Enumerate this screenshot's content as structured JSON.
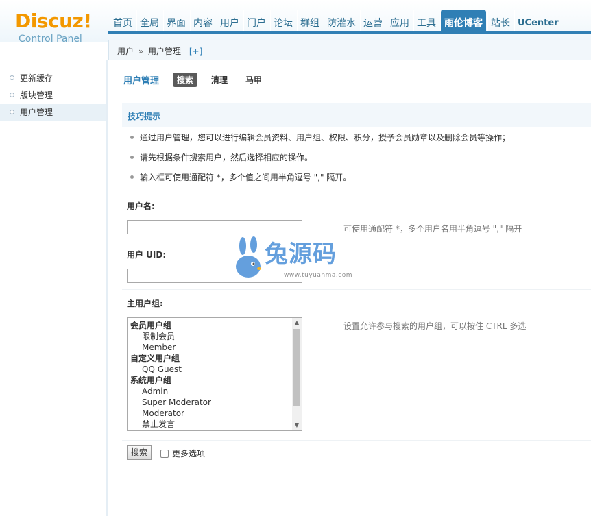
{
  "logo": {
    "brand": "Discuz!",
    "subtitle": "Control Panel"
  },
  "topnav": {
    "items": [
      "首页",
      "全局",
      "界面",
      "内容",
      "用户",
      "门户",
      "论坛",
      "群组",
      "防灌水",
      "运营",
      "应用",
      "工具",
      "雨伦博客",
      "站长",
      "UCenter"
    ],
    "active_index": 12
  },
  "breadcrumb": {
    "root": "用户",
    "separator": "»",
    "current": "用户管理",
    "add_label": "[+]"
  },
  "sidebar": {
    "items": [
      {
        "label": "更新缓存"
      },
      {
        "label": "版块管理"
      },
      {
        "label": "用户管理"
      }
    ],
    "active_index": 2
  },
  "main": {
    "title": "用户管理",
    "tabs": [
      "搜索",
      "清理",
      "马甲"
    ],
    "active_tab_index": 0,
    "tips_title": "技巧提示",
    "tips": [
      "通过用户管理，您可以进行编辑会员资料、用户组、权限、积分，授予会员勋章以及删除会员等操作；",
      "请先根据条件搜索用户，然后选择相应的操作。",
      "输入框可使用通配符 *，多个值之间用半角逗号 \",\" 隔开。"
    ],
    "username": {
      "label": "用户名:",
      "value": "",
      "hint": "可使用通配符 *，多个用户名用半角逗号 \",\" 隔开"
    },
    "uid": {
      "label": "用户 UID:",
      "value": ""
    },
    "group": {
      "label": "主用户组:",
      "hint": "设置允许参与搜索的用户组，可以按住 CTRL 多选",
      "options": [
        {
          "text": "会员用户组",
          "kind": "group"
        },
        {
          "text": "限制会员",
          "kind": "child"
        },
        {
          "text": "Member",
          "kind": "child"
        },
        {
          "text": "自定义用户组",
          "kind": "group"
        },
        {
          "text": "QQ Guest",
          "kind": "child"
        },
        {
          "text": "系统用户组",
          "kind": "group"
        },
        {
          "text": "Admin",
          "kind": "child"
        },
        {
          "text": "Super Moderator",
          "kind": "child"
        },
        {
          "text": "Moderator",
          "kind": "child"
        },
        {
          "text": "禁止发言",
          "kind": "child"
        }
      ]
    },
    "search_button": "搜索",
    "more_options": "更多选项",
    "more_options_checked": false
  },
  "watermark": {
    "text": "兔源码",
    "url": "www.tuyuanma.com"
  },
  "colors": {
    "accent": "#2f7fb5",
    "logo": "#f39800",
    "watermark": "#4a8fd8"
  }
}
